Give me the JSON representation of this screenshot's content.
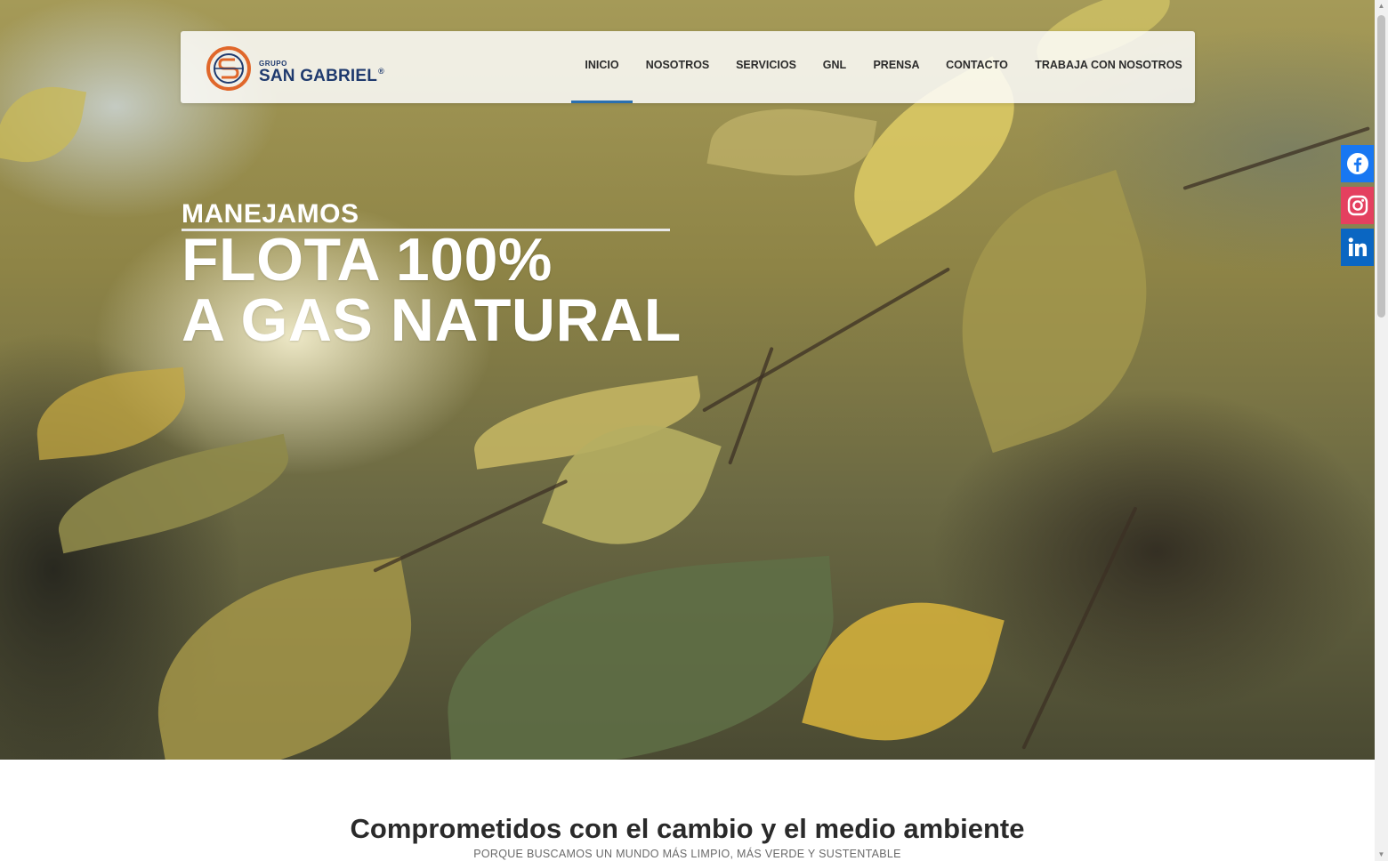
{
  "header": {
    "logo": {
      "small_text": "GRUPO",
      "name": "SAN GABRIEL",
      "registered": "®"
    },
    "nav": [
      {
        "label": "INICIO",
        "active": true
      },
      {
        "label": "NOSOTROS",
        "active": false
      },
      {
        "label": "SERVICIOS",
        "active": false
      },
      {
        "label": "GNL",
        "active": false
      },
      {
        "label": "PRENSA",
        "active": false
      },
      {
        "label": "CONTACTO",
        "active": false
      },
      {
        "label": "TRABAJA CON NOSOTROS",
        "active": false
      }
    ]
  },
  "hero": {
    "kicker": "MANEJAMOS",
    "line1": "FLOTA 100%",
    "line2": "A GAS NATURAL"
  },
  "social": [
    {
      "icon": "facebook-icon",
      "color": "#1877f2"
    },
    {
      "icon": "instagram-icon",
      "color": "#e4405f"
    },
    {
      "icon": "linkedin-icon",
      "color": "#0a66c2"
    }
  ],
  "section": {
    "title": "Comprometidos con el cambio y el medio ambiente",
    "subtitle": "PORQUE BUSCAMOS UN MUNDO MÁS LIMPIO, MÁS VERDE Y SUSTENTABLE"
  },
  "colors": {
    "brand_blue": "#1f3a6e",
    "brand_orange": "#e0672a",
    "nav_active": "#2a6fb0"
  }
}
